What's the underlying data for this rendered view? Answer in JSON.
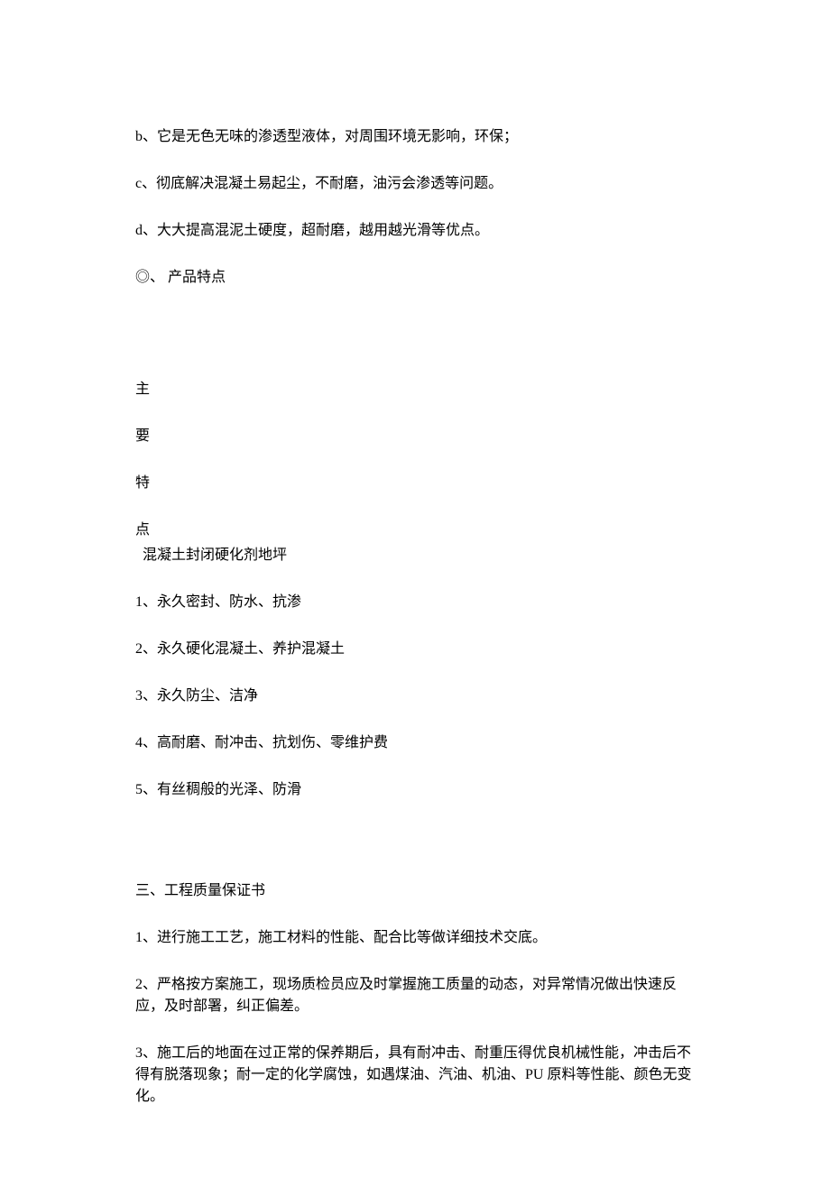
{
  "lines": {
    "b": "b、它是无色无味的渗透型液体，对周围环境无影响，环保；",
    "c": "c、彻底解决混凝土易起尘，不耐磨，油污会渗透等问题。",
    "d": "d、大大提高混泥土硬度，超耐磨，越用越光滑等优点。"
  },
  "product_features_heading": "◎、 产品特点",
  "vert": {
    "v1": "主",
    "v2": "要",
    "v3": "特",
    "v4": "点"
  },
  "sub_heading": "混凝土封闭硬化剂地坪",
  "features": {
    "f1": "1、永久密封、防水、抗渗",
    "f2": "2、永久硬化混凝土、养护混凝土",
    "f3": "3、永久防尘、洁净",
    "f4": "4、高耐磨、耐冲击、抗划伤、零维护费",
    "f5": "5、有丝稠般的光泽、防滑"
  },
  "section3_heading": "三、工程质量保证书",
  "section3": {
    "p1": "1、进行施工工艺，施工材料的性能、配合比等做详细技术交底。",
    "p2": "2、严格按方案施工，现场质检员应及时掌握施工质量的动态，对异常情况做出快速反应，及时部署，纠正偏差。",
    "p3": "3、施工后的地面在过正常的保养期后，具有耐冲击、耐重压得优良机械性能，冲击后不得有脱落现象；耐一定的化学腐蚀，如遇煤油、汽油、机油、PU 原料等性能、颜色无变化。"
  }
}
